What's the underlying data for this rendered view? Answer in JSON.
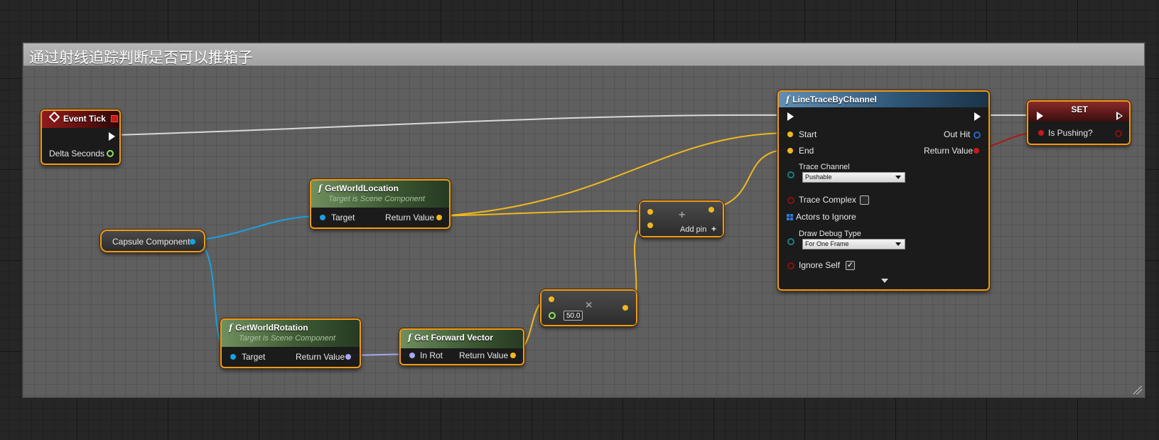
{
  "comment": {
    "title": "通过射线追踪判断是否可以推箱子"
  },
  "nodes": {
    "event_tick": {
      "title": "Event Tick",
      "pins": {
        "delta_seconds": "Delta Seconds"
      }
    },
    "capsule": {
      "title": "Capsule Component"
    },
    "get_world_location": {
      "title": "GetWorldLocation",
      "subtitle": "Target is Scene Component",
      "pins": {
        "target": "Target",
        "return_value": "Return Value"
      }
    },
    "get_world_rotation": {
      "title": "GetWorldRotation",
      "subtitle": "Target is Scene Component",
      "pins": {
        "target": "Target",
        "return_value": "Return Value"
      }
    },
    "get_forward_vector": {
      "title": "Get Forward Vector",
      "pins": {
        "in_rot": "In Rot",
        "return_value": "Return Value"
      }
    },
    "multiply": {
      "value": "50.0"
    },
    "add": {
      "add_pin": "Add pin"
    },
    "line_trace": {
      "title": "LineTraceByChannel",
      "pins": {
        "start": "Start",
        "end": "End",
        "out_hit": "Out Hit",
        "return_value": "Return Value",
        "trace_channel": "Trace Channel",
        "trace_complex": "Trace Complex",
        "actors_to_ignore": "Actors to Ignore",
        "draw_debug_type": "Draw Debug Type",
        "ignore_self": "Ignore Self"
      },
      "trace_channel_value": "Pushable",
      "draw_debug_value": "For One Frame",
      "trace_complex_checked": false,
      "ignore_self_checked": true
    },
    "set": {
      "title": "SET",
      "pins": {
        "is_pushing": "Is Pushing?"
      }
    }
  },
  "icons": {
    "function": "f-function-icon",
    "event": "diamond-event-icon",
    "add": "plus-icon",
    "multiply": "x-multiply-icon",
    "array": "grid-array-icon",
    "expand": "chevron-down-icon"
  },
  "colors": {
    "node_border": "#ec9a1e",
    "vector_pin": "#f0b81e",
    "object_pin": "#1aa0e0",
    "rotator_pin": "#a7a7f0",
    "bool_pin": "#c41a1a",
    "float_pin": "#90e060",
    "exec_wire": "#d8d8d8"
  }
}
